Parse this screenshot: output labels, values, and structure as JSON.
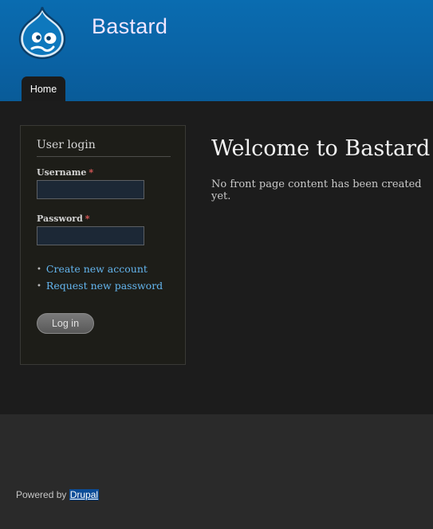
{
  "site": {
    "name": "Bastard"
  },
  "nav": {
    "tabs": [
      {
        "label": "Home"
      }
    ]
  },
  "login": {
    "title": "User login",
    "username_label": "Username",
    "password_label": "Password",
    "required_marker": "*",
    "username_value": "",
    "password_value": "",
    "links": [
      "Create new account",
      "Request new password"
    ],
    "bullet": "•",
    "submit_label": "Log in"
  },
  "content": {
    "title": "Welcome to Bastard",
    "text": "No front page content has been created yet."
  },
  "footer": {
    "powered_prefix": "Powered by",
    "powered_link": "Drupal"
  },
  "colors": {
    "header_blue": "#0a6cb0",
    "link_blue": "#64b6ef",
    "required_red": "#e05a5a"
  }
}
